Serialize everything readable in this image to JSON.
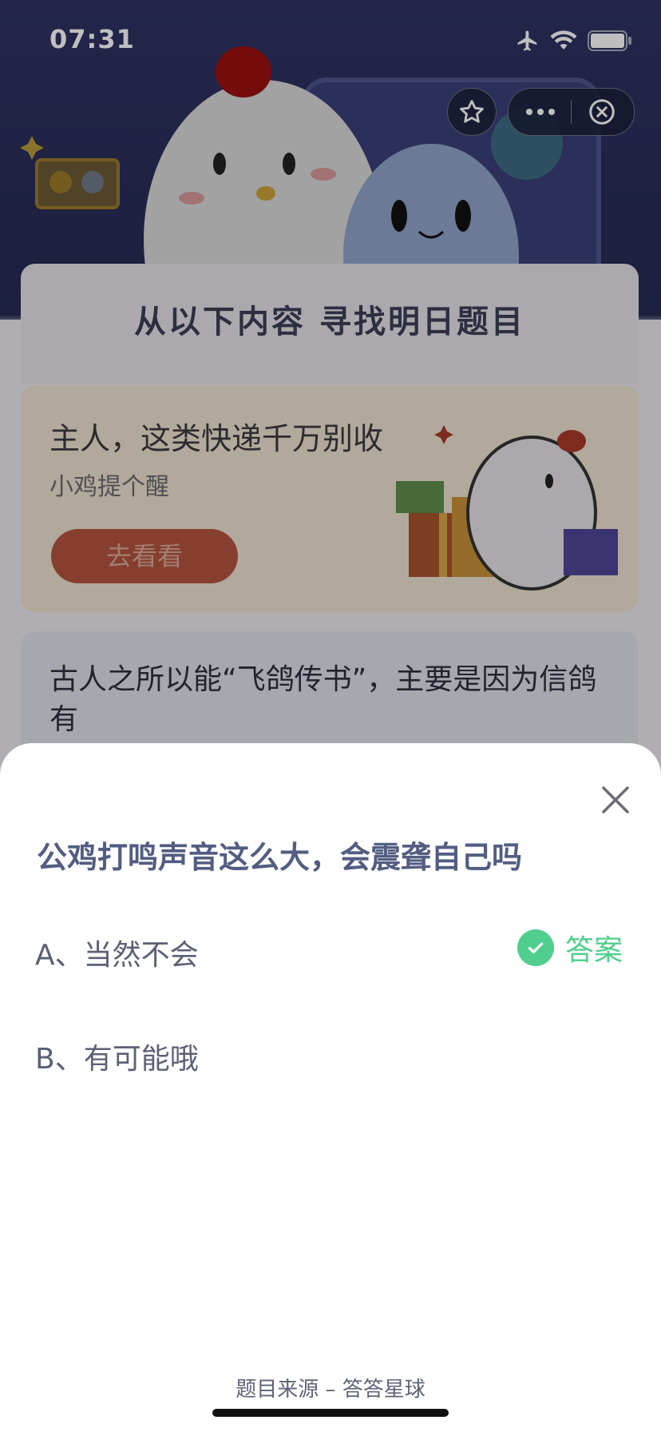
{
  "status_bar": {
    "time": "07:31",
    "icons": [
      "airplane-icon",
      "wifi-icon",
      "battery-icon"
    ]
  },
  "mini_program_capsule": {
    "icons": [
      "star-icon",
      "more-icon",
      "close-circle-icon"
    ]
  },
  "banner": {
    "title": "从以下内容 寻找明日题目"
  },
  "promo": {
    "title": "主人，这类快递千万别收",
    "subtitle": "小鸡提个醒",
    "button_label": "去看看"
  },
  "background_question": {
    "text": "古人之所以能“飞鸽传书”，主要是因为信鸽有"
  },
  "sheet": {
    "question": "公鸡打鸣声音这么大，会震聋自己吗",
    "options": [
      {
        "label": "A、当然不会",
        "is_answer": true
      },
      {
        "label": "B、有可能哦",
        "is_answer": false
      }
    ],
    "answer_label": "答案",
    "source": "题目来源 – 答答星球"
  },
  "colors": {
    "accent_green": "#4fce8d",
    "question_title": "#535d82",
    "promo_button": "#b3553e"
  }
}
